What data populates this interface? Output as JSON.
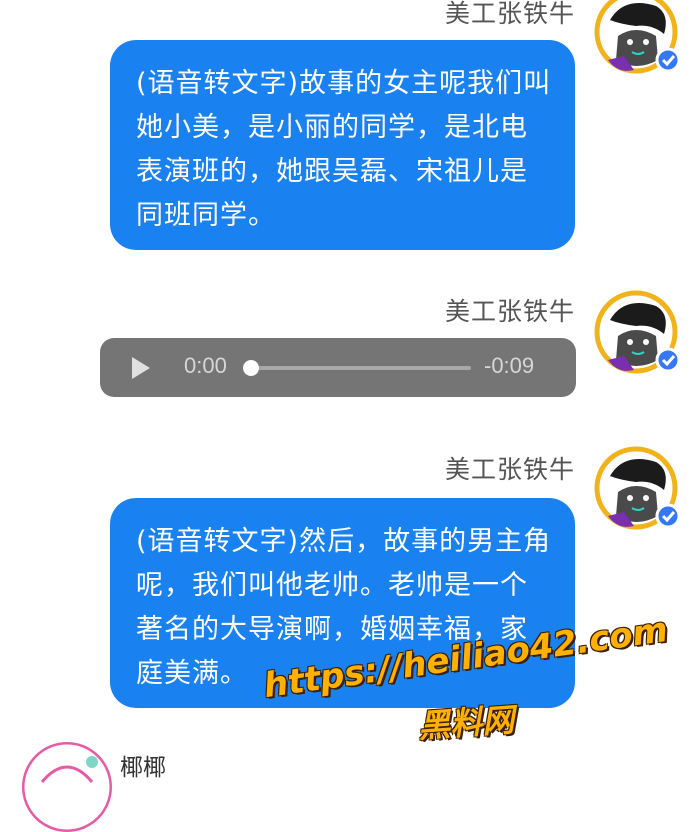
{
  "messages": [
    {
      "sender": "美工张铁牛",
      "type": "text",
      "text": "(语音转文字)故事的女主呢我们叫她小美，是小丽的同学，是北电表演班的，她跟吴磊、宋祖儿是同班同学。"
    },
    {
      "sender": "美工张铁牛",
      "type": "audio",
      "elapsed": "0:00",
      "remaining": "-0:09",
      "progress": 0
    },
    {
      "sender": "美工张铁牛",
      "type": "text",
      "text": "(语音转文字)然后，故事的男主角呢，我们叫他老帅。老帅是一个著名的大导演啊，婚姻幸福，家庭美满。"
    }
  ],
  "next_sender": "椰椰",
  "watermark": {
    "url": "https://heiliao42.com",
    "name": "黑料网"
  },
  "colors": {
    "bubble": "#1a82f0",
    "audio_bar": "#757575",
    "avatar_ring": "#f2b21c",
    "verified_badge": "#3478f6",
    "watermark": "#ffb000"
  },
  "icons": [
    "avatar-cartoon-icon",
    "verified-badge-icon",
    "play-icon"
  ]
}
